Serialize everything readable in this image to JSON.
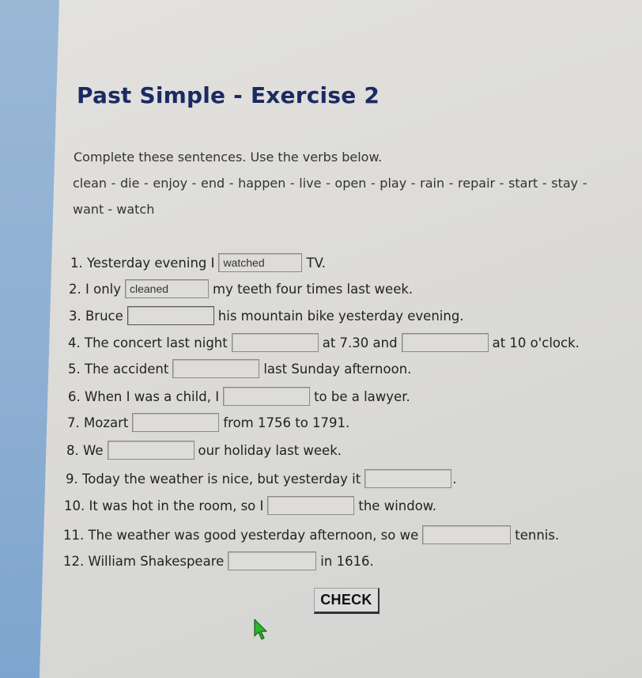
{
  "page": {
    "title": "Past Simple - Exercise 2",
    "instruction": "Complete these sentences. Use the verbs below.",
    "verbs_line1": "clean - die - enjoy - end - happen - live - open - play - rain - repair - start - stay -",
    "verbs_line2": "want - watch"
  },
  "sentences": [
    {
      "parts": [
        "1. Yesterday evening I",
        "TV."
      ],
      "answers": [
        "watched"
      ]
    },
    {
      "parts": [
        "2. I only",
        "my teeth four times last week."
      ],
      "answers": [
        "cleaned"
      ]
    },
    {
      "parts": [
        "3. Bruce",
        "his mountain bike yesterday evening."
      ],
      "answers": [
        ""
      ]
    },
    {
      "parts": [
        "4. The concert last night",
        "at 7.30 and",
        "at 10 o'clock."
      ],
      "answers": [
        "",
        ""
      ]
    },
    {
      "parts": [
        "5. The accident",
        "last Sunday afternoon."
      ],
      "answers": [
        ""
      ]
    },
    {
      "parts": [
        "6. When I was a child, I",
        "to be a lawyer."
      ],
      "answers": [
        ""
      ]
    },
    {
      "parts": [
        "7. Mozart",
        "from 1756 to 1791."
      ],
      "answers": [
        ""
      ]
    },
    {
      "parts": [
        "8. We",
        "our holiday last week."
      ],
      "answers": [
        ""
      ]
    },
    {
      "parts": [
        "9. Today the weather is nice, but yesterday it",
        "."
      ],
      "answers": [
        ""
      ]
    },
    {
      "parts": [
        "10. It was hot in the room, so I",
        "the window."
      ],
      "answers": [
        ""
      ]
    },
    {
      "parts": [
        "11. The weather was good yesterday afternoon, so we",
        "tennis."
      ],
      "answers": [
        ""
      ]
    },
    {
      "parts": [
        "12. William Shakespeare",
        "in 1616."
      ],
      "answers": [
        ""
      ]
    }
  ],
  "check_button": {
    "label": "CHECK"
  },
  "colors": {
    "title": "#1b2a63",
    "side_strip": "#8fb0d2",
    "cursor": "#2db52d"
  }
}
